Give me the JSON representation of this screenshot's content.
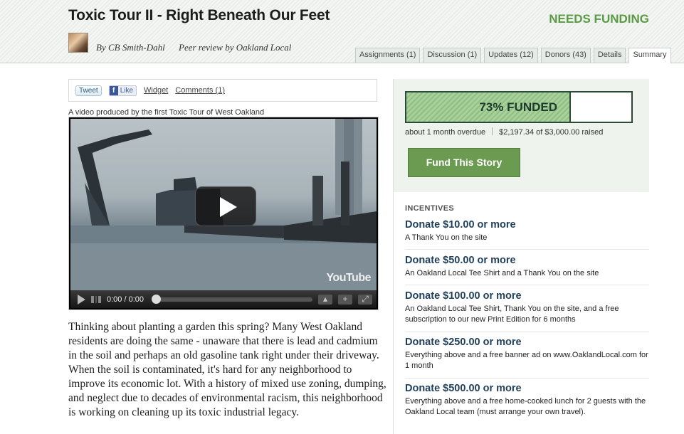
{
  "header": {
    "title": "Toxic Tour II - Right Beneath Our Feet",
    "status": "NEEDS FUNDING",
    "author": "By CB Smith-Dahl",
    "peer_review": "Peer review by Oakland Local",
    "tabs": [
      {
        "label": "Assignments (1)"
      },
      {
        "label": "Discussion (1)"
      },
      {
        "label": "Updates (12)"
      },
      {
        "label": "Donors (43)"
      },
      {
        "label": "Details"
      },
      {
        "label": "Summary",
        "active": true
      }
    ]
  },
  "share": {
    "tweet": "Tweet",
    "like": "Like",
    "widget": "Widget",
    "comments": "Comments (1)"
  },
  "video": {
    "caption": "A video produced by the first Toxic Tour of West Oakland",
    "time": "0:00 / 0:00",
    "progress": 0,
    "logo": "YouTube"
  },
  "story": {
    "body": "Thinking about planting a garden this spring? Many West Oakland residents are doing the same - unaware that there is lead and cadmium in the soil and perhaps an old gasoline tank right under their driveway. When the soil is contaminated, it's hard for any neighborhood to improve its economic lot. With a history of mixed use zoning, dumping, and neglect due to decades of environmental racism, this neighborhood is working on cleaning up its toxic industrial legacy."
  },
  "funding": {
    "percent": 73,
    "label": "73% FUNDED",
    "overdue": "about 1 month overdue",
    "raised": "$2,197.34 of $3,000.00 raised",
    "button": "Fund This Story"
  },
  "incentives": {
    "title": "INCENTIVES",
    "items": [
      {
        "amount": "Donate $10.00 or more",
        "desc": "A Thank You on the site"
      },
      {
        "amount": "Donate $50.00 or more",
        "desc": "An Oakland Local Tee Shirt and a Thank You on the site"
      },
      {
        "amount": "Donate $100.00 or more",
        "desc": "An Oakland Local Tee Shirt, Thank You on the site, and a free subscription to our new Print Edition for 6 months"
      },
      {
        "amount": "Donate $250.00 or more",
        "desc": "Everything above and a free banner ad on www.OaklandLocal.com for 1 month"
      },
      {
        "amount": "Donate $500.00 or more",
        "desc": "Everything above and a free home-cooked lunch for 2 guests with the Oakland Local team (must arrange your own travel)."
      }
    ]
  },
  "colors": {
    "accent_green": "#5b9a45",
    "button_green": "#6b9b50",
    "incentive_blue": "#1f3f5a"
  }
}
